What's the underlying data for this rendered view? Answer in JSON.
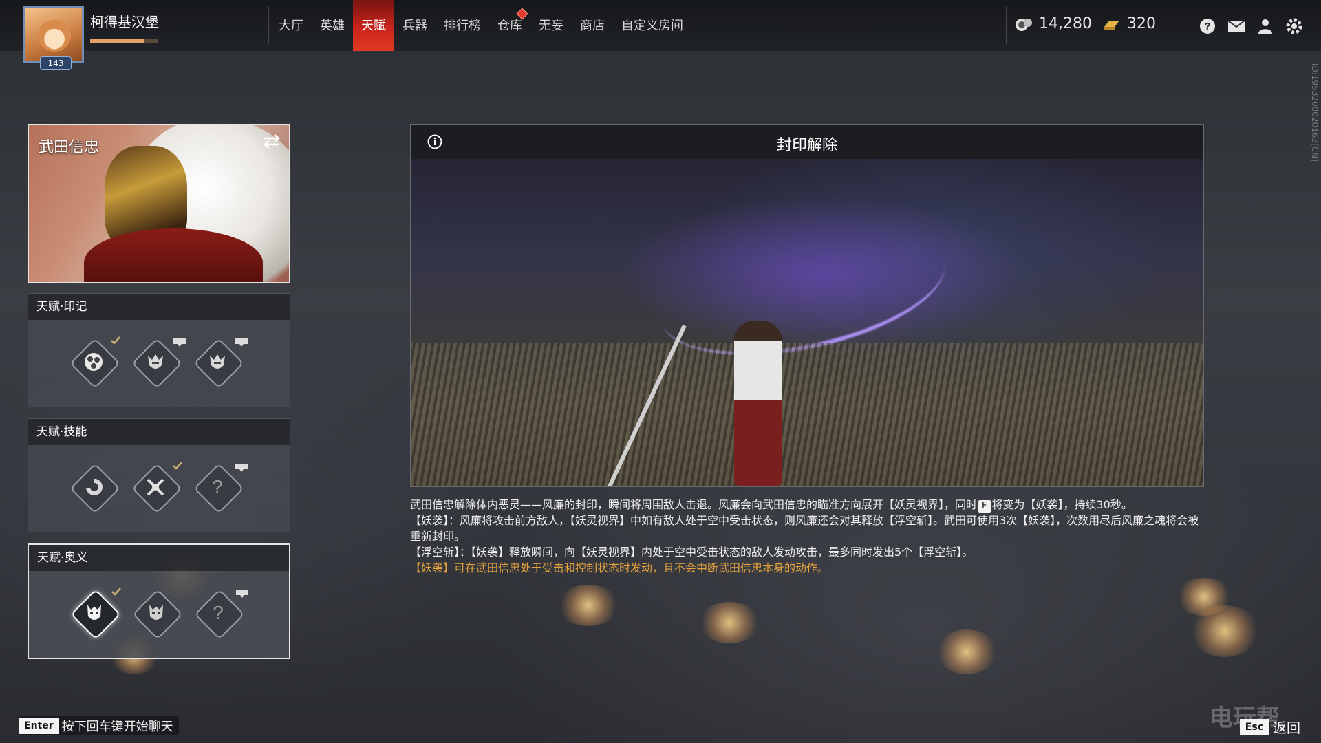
{
  "player": {
    "name": "柯得基汉堡",
    "level": "143",
    "exp_fraction": 0.8
  },
  "nav": {
    "tabs": [
      "大厅",
      "英雄",
      "天赋",
      "兵器",
      "排行榜",
      "仓库",
      "无妄",
      "商店",
      "自定义房间"
    ],
    "active_index": 2
  },
  "currency": {
    "coins": "14,280",
    "gold": "320"
  },
  "hero": {
    "name": "武田信忠"
  },
  "talents": {
    "mark": {
      "title": "天赋·印记"
    },
    "skill": {
      "title": "天赋·技能"
    },
    "ultimate": {
      "title": "天赋·奥义"
    }
  },
  "detail": {
    "title": "封印解除",
    "line1_a": "武田信忠解除体内恶灵——风廉的封印，瞬间将周围敌人击退。风廉会向武田信忠的瞄准方向展开【妖灵视界】，同时",
    "key_f": "F",
    "line1_b": "将变为【妖袭】，持续30秒。",
    "line2": "【妖袭】：风廉将攻击前方敌人，【妖灵视界】中如有敌人处于空中受击状态，则风廉还会对其释放【浮空斩】。武田可使用3次【妖袭】，次数用尽后风廉之魂将会被重新封印。",
    "line3": "【浮空斩】：【妖袭】释放瞬间，向【妖灵视界】内处于空中受击状态的敌人发动攻击，最多同时发出5个【浮空斩】。",
    "line4": "【妖袭】可在武田信忠处于受击和控制状态时发动，且不会中断武田信忠本身的动作。"
  },
  "bottom": {
    "enter_key": "Enter",
    "chat_hint": "按下回车键开始聊天",
    "esc_key": "Esc",
    "back_label": "返回",
    "watermark": "电玩帮"
  },
  "side_id": "ID:1953200020163[CN]",
  "colors": {
    "accent_red": "#c8241b",
    "highlight_orange": "#e5a23f"
  },
  "icons": [
    "help-icon",
    "mail-icon",
    "friends-icon",
    "settings-icon",
    "swap-icon",
    "info-icon",
    "lock-icon",
    "check-icon"
  ]
}
